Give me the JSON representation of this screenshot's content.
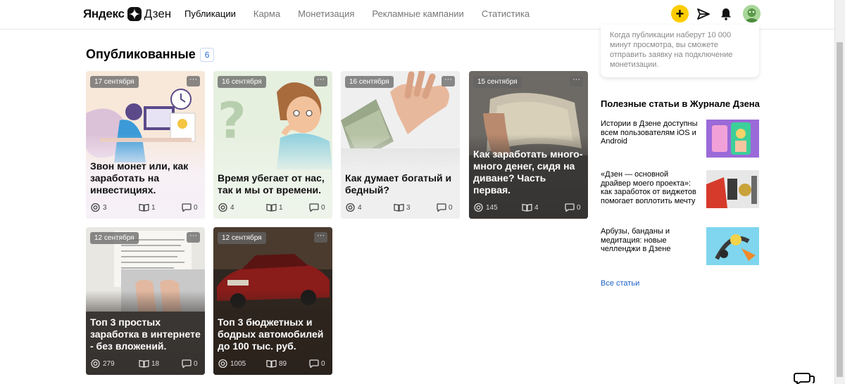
{
  "header": {
    "logo_part1": "Яндекс",
    "logo_part2": "Дзен",
    "nav": [
      {
        "label": "Публикации",
        "active": true
      },
      {
        "label": "Карма",
        "active": false
      },
      {
        "label": "Монетизация",
        "active": false
      },
      {
        "label": "Рекламные кампании",
        "active": false
      },
      {
        "label": "Статистика",
        "active": false
      }
    ],
    "plus_label": "+",
    "icons": [
      "send-icon",
      "bell-icon"
    ]
  },
  "section": {
    "title": "Опубликованные",
    "count": "6"
  },
  "cards": [
    {
      "date": "17 сентября",
      "title": "Звон монет или, как заработать на инвестициях.",
      "views": "3",
      "reads": "1",
      "comments": "0",
      "theme": "light"
    },
    {
      "date": "16 сентября",
      "title": "Время убегает от нас, так и мы от времени.",
      "views": "4",
      "reads": "1",
      "comments": "0",
      "theme": "light"
    },
    {
      "date": "16 сентября",
      "title": "Как думает богатый и бедный?",
      "views": "4",
      "reads": "3",
      "comments": "0",
      "theme": "light"
    },
    {
      "date": "15 сентября",
      "title": "Как заработать много-много денег, сидя на диване? Часть первая.",
      "views": "145",
      "reads": "4",
      "comments": "0",
      "theme": "dark"
    },
    {
      "date": "12 сентября",
      "title": "Топ 3 простых заработка в интернете - без вложений.",
      "views": "279",
      "reads": "18",
      "comments": "0",
      "theme": "dark"
    },
    {
      "date": "12 сентября",
      "title": "Топ 3 бюджетных и бодрых автомобилей до 100 тыс. руб.",
      "views": "1005",
      "reads": "89",
      "comments": "0",
      "theme": "dark"
    }
  ],
  "card_menu_label": "···",
  "sidebar": {
    "monetization_note": "Когда публикации наберут 10 000 минут просмотра, вы сможете отправить заявку на подключение монетизации.",
    "articles_title": "Полезные статьи в Журнале Дзена",
    "articles": [
      {
        "text": "Истории в Дзене доступны всем пользователям iOS и Android"
      },
      {
        "text": "«Дзен — основной драйвер моего проекта»: как заработок от виджетов помогает воплотить мечту"
      },
      {
        "text": "Арбузы, банданы и медитация: новые челленджи в Дзене"
      }
    ],
    "all_articles_label": "Все статьи"
  },
  "colors": {
    "accent_yellow": "#ffcc00",
    "link_blue": "#1a5fc8"
  }
}
